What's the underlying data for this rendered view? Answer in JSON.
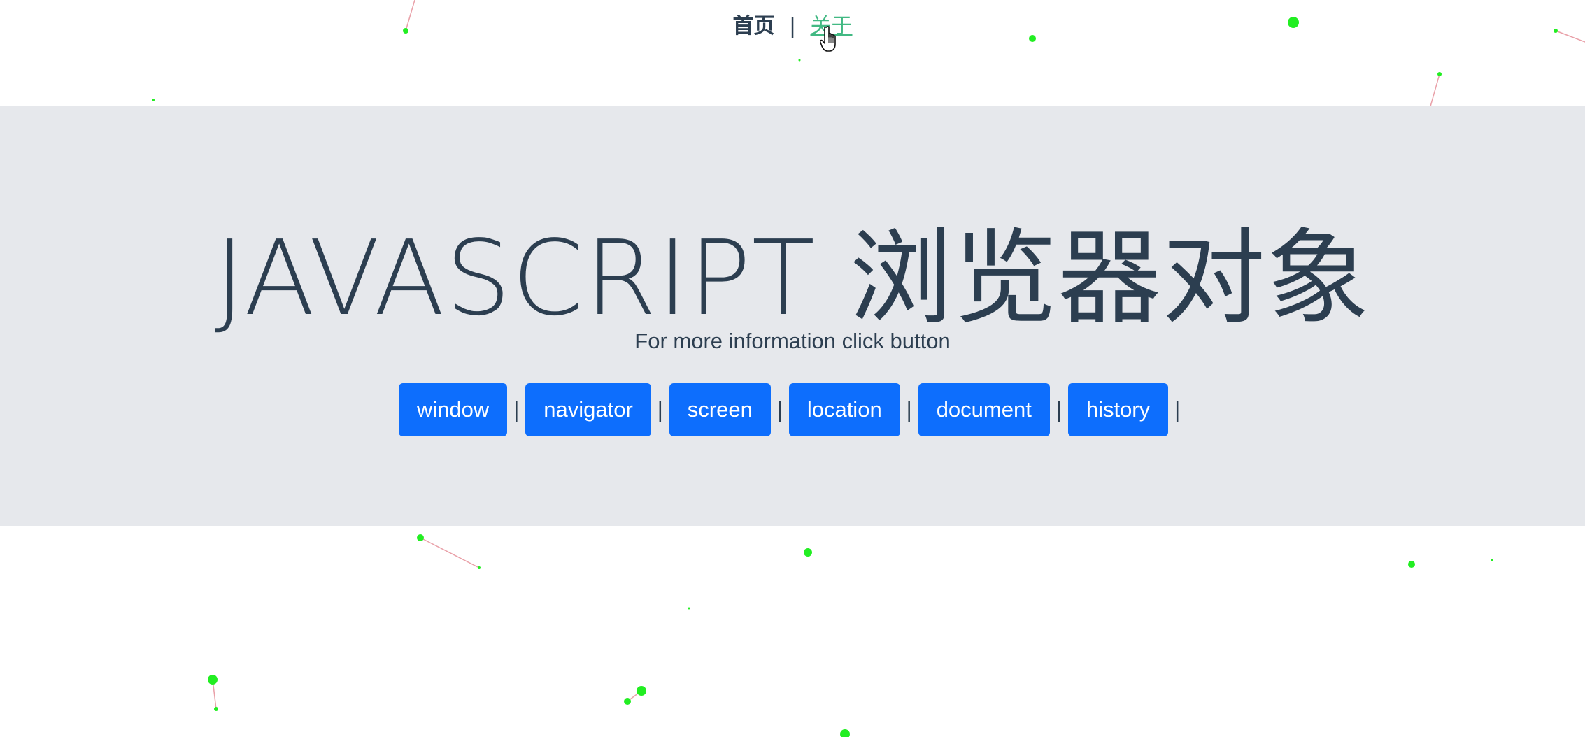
{
  "nav": {
    "home_label": "首页",
    "separator": "|",
    "about_label": "关于"
  },
  "hero": {
    "title": "JAVASCRIPT 浏览器对象",
    "subtitle": "For more information click button",
    "separator": "|",
    "buttons": [
      {
        "label": "window"
      },
      {
        "label": "navigator"
      },
      {
        "label": "screen"
      },
      {
        "label": "location"
      },
      {
        "label": "document"
      },
      {
        "label": "history"
      }
    ]
  },
  "colors": {
    "link_active": "#42b983",
    "button_bg": "#0d6efd",
    "jumbotron_bg": "#e6e8ec",
    "text": "#2c3e50",
    "particle": "#22ee22"
  }
}
